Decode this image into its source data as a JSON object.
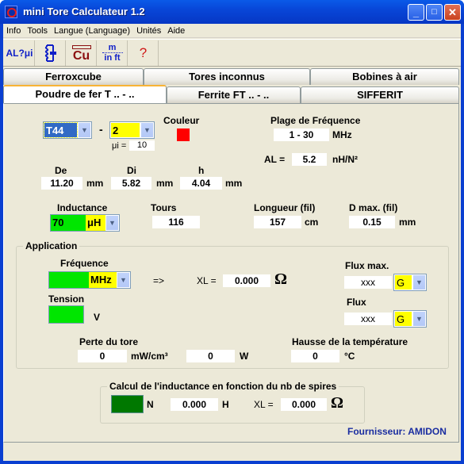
{
  "window": {
    "title": "mini Tore Calculateur 1.2",
    "minimize": "_",
    "maximize": "□",
    "close": "✕"
  },
  "menu": [
    "Info",
    "Tools",
    "Langue (Language)",
    "Unités",
    "Aide"
  ],
  "toolbar": [
    {
      "icon": "al-mu-icon",
      "label": "AL?μi"
    },
    {
      "icon": "lc-circuit-icon",
      "label": "LC"
    },
    {
      "icon": "copper-wire-icon",
      "label": "Cu"
    },
    {
      "icon": "unit-convert-icon",
      "label_top": "m",
      "label_bottom": "in ft"
    },
    {
      "icon": "help-icon",
      "label": "?"
    }
  ],
  "tabs": {
    "row1": [
      "Ferroxcube",
      "Tores inconnus",
      "Bobines à air"
    ],
    "row2": [
      "Poudre de fer T .. - ..",
      "Ferrite FT .. - ..",
      "SIFFERIT"
    ],
    "active": "Poudre de fer T .. - .."
  },
  "core": {
    "size": "T44",
    "material": "2",
    "mu_label": "μi =",
    "mu_value": "10",
    "color_label": "Couleur",
    "color_hex": "#ff0000",
    "freq_range_label": "Plage de Fréquence",
    "freq_range": "1 - 30",
    "freq_range_unit": "MHz",
    "al_label": "AL =",
    "al_value": "5.2",
    "al_unit": "nH/N²"
  },
  "dims": {
    "de_label": "De",
    "de": "11.20",
    "di_label": "Di",
    "di": "5.82",
    "h_label": "h",
    "h": "4.04",
    "unit": "mm"
  },
  "coil": {
    "inductance_label": "Inductance",
    "inductance": "70",
    "inductance_unit": "μH",
    "tours_label": "Tours",
    "tours": "116",
    "longueur_label": "Longueur (fil)",
    "longueur": "157",
    "longueur_unit": "cm",
    "dmax_label": "D max. (fil)",
    "dmax": "0.15",
    "dmax_unit": "mm"
  },
  "application": {
    "title": "Application",
    "freq_label": "Fréquence",
    "freq_value": "",
    "freq_unit": "MHz",
    "arrow": "=>",
    "xl_label": "XL =",
    "xl": "0.000",
    "ohm": "Ω",
    "tension_label": "Tension",
    "tension_value": "",
    "tension_unit": "V",
    "flux_max_label": "Flux max.",
    "flux_max": "xxx",
    "flux_max_unit": "G",
    "flux_label": "Flux",
    "flux": "xxx",
    "flux_unit": "G",
    "perte_label": "Perte du tore",
    "perte1": "0",
    "perte1_unit": "mW/cm³",
    "perte2": "0",
    "perte2_unit": "W",
    "hausse_label": "Hausse de la température",
    "hausse": "0",
    "hausse_unit": "°C"
  },
  "calc": {
    "title": "Calcul de l'inductance en fonction du nb de spires",
    "n_value": "",
    "n_label": "N",
    "h_value": "0.000",
    "h_unit": "H",
    "xl_label": "XL =",
    "xl": "0.000",
    "ohm": "Ω"
  },
  "supplier": "Fournisseur: AMIDON"
}
